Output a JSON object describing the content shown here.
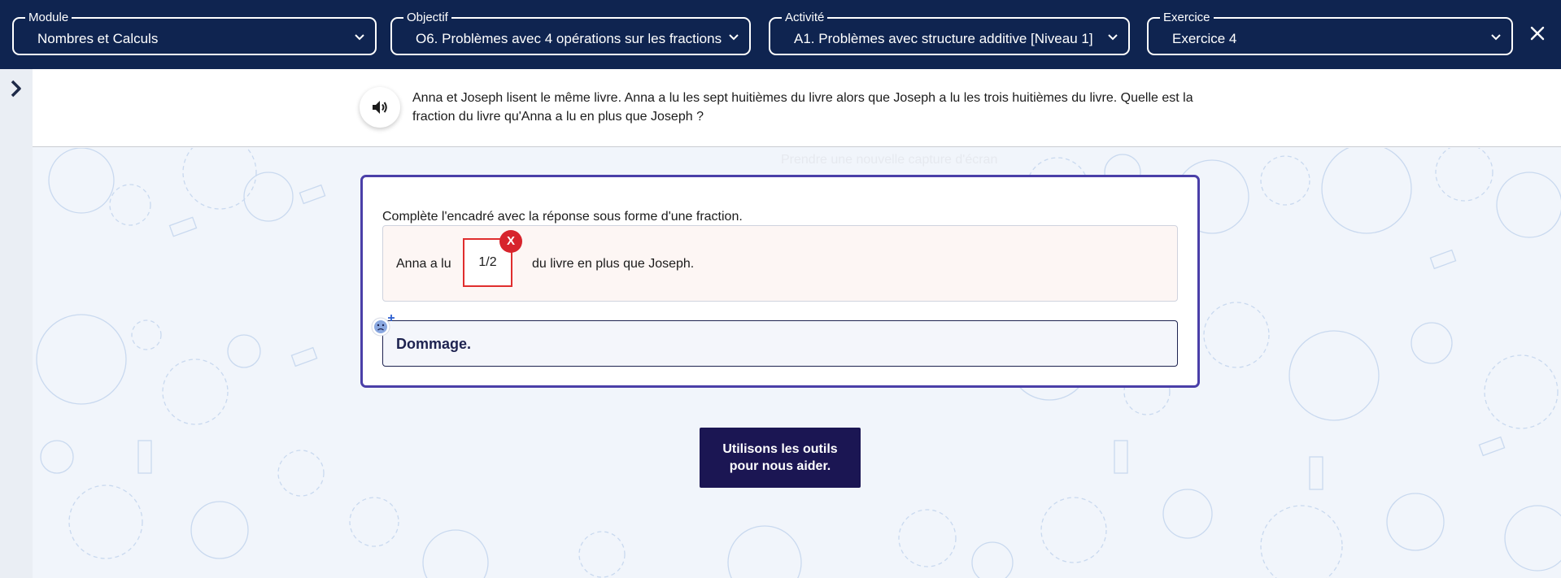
{
  "header": {
    "selects": [
      {
        "label": "Module",
        "value": "Nombres et Calculs"
      },
      {
        "label": "Objectif",
        "value": "O6. Problèmes avec 4 opérations sur les fractions"
      },
      {
        "label": "Activité",
        "value": "A1. Problèmes avec structure additive [Niveau 1]"
      },
      {
        "label": "Exercice",
        "value": "Exercice 4"
      }
    ]
  },
  "question": {
    "text": "Anna et Joseph lisent le même livre. Anna a lu les sept huitièmes du livre alors que Joseph a lu les trois huitièmes du livre. Quelle est la fraction du livre qu'Anna a lu en plus que Joseph ?"
  },
  "background_hint": "Prendre une nouvelle capture d'écran",
  "exercise": {
    "instruction": "Complète l'encadré avec la réponse sous forme d'une fraction.",
    "answer_prefix": "Anna a lu",
    "answer_value": "1/2",
    "answer_suffix": "du livre en plus que Joseph.",
    "error_mark": "X",
    "feedback": "Dommage."
  },
  "help_button": {
    "line1": "Utilisons les outils",
    "line2": "pour nous aider."
  },
  "colors": {
    "header_bg": "#0f2450",
    "card_border": "#4a3fa8",
    "error_red": "#d7242c",
    "button_bg": "#1b1653"
  },
  "icons": {
    "close": "close-icon",
    "expand": "chevron-right-icon",
    "audio": "speaker-icon",
    "mascot": "sad-face-icon"
  }
}
